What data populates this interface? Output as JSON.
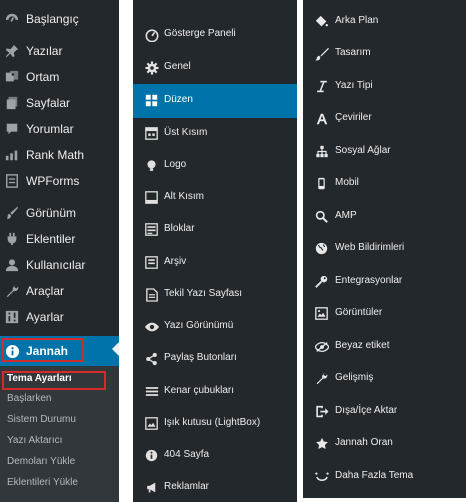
{
  "admin_menu": {
    "items": [
      {
        "label": "Başlangıç",
        "icon": "dashboard-icon"
      },
      {
        "label": "Yazılar",
        "icon": "pin-icon"
      },
      {
        "label": "Ortam",
        "icon": "media-icon"
      },
      {
        "label": "Sayfalar",
        "icon": "pages-icon"
      },
      {
        "label": "Yorumlar",
        "icon": "comments-icon"
      },
      {
        "label": "Rank Math",
        "icon": "rank-math-icon"
      },
      {
        "label": "WPForms",
        "icon": "wpforms-icon"
      },
      {
        "label": "Görünüm",
        "icon": "appearance-icon"
      },
      {
        "label": "Eklentiler",
        "icon": "plugins-icon"
      },
      {
        "label": "Kullanıcılar",
        "icon": "users-icon"
      },
      {
        "label": "Araçlar",
        "icon": "tools-icon"
      },
      {
        "label": "Ayarlar",
        "icon": "settings-icon"
      },
      {
        "label": "Jannah",
        "icon": "info-icon",
        "active": true
      }
    ],
    "submenu": [
      {
        "label": "Tema Ayarları",
        "current": true
      },
      {
        "label": "Başlarken"
      },
      {
        "label": "Sistem Durumu"
      },
      {
        "label": "Yazı Aktarıcı"
      },
      {
        "label": "Demoları Yükle"
      },
      {
        "label": "Eklentileri Yükle"
      }
    ]
  },
  "theme_panel_left": {
    "items": [
      {
        "label": "Gösterge Paneli",
        "icon": "gauge-icon"
      },
      {
        "label": "Genel",
        "icon": "gear-icon"
      },
      {
        "label": "Düzen",
        "icon": "layout-icon",
        "active": true
      },
      {
        "label": "Üst Kısım",
        "icon": "header-icon"
      },
      {
        "label": "Logo",
        "icon": "lightbulb-icon"
      },
      {
        "label": "Alt Kısım",
        "icon": "footer-icon"
      },
      {
        "label": "Bloklar",
        "icon": "blocks-icon"
      },
      {
        "label": "Arşiv",
        "icon": "archive-icon"
      },
      {
        "label": "Tekil Yazı Sayfası",
        "icon": "document-icon"
      },
      {
        "label": "Yazı Görünümü",
        "icon": "eye-icon"
      },
      {
        "label": "Paylaş Butonları",
        "icon": "share-icon"
      },
      {
        "label": "Kenar çubukları",
        "icon": "sidebars-icon"
      },
      {
        "label": "Işık kutusu (LightBox)",
        "icon": "lightbox-icon"
      },
      {
        "label": "404 Sayfa",
        "icon": "info-circle-icon"
      },
      {
        "label": "Reklamlar",
        "icon": "megaphone-icon"
      }
    ]
  },
  "theme_panel_right": {
    "items": [
      {
        "label": "Arka Plan",
        "icon": "paint-bucket-icon"
      },
      {
        "label": "Tasarım",
        "icon": "brush-icon"
      },
      {
        "label": "Yazı Tipi",
        "icon": "italic-icon"
      },
      {
        "label": "Çeviriler",
        "icon": "letter-a-icon"
      },
      {
        "label": "Sosyal Ağlar",
        "icon": "sitemap-icon"
      },
      {
        "label": "Mobil",
        "icon": "mobile-icon"
      },
      {
        "label": "AMP",
        "icon": "search-icon"
      },
      {
        "label": "Web Bildirimleri",
        "icon": "globe-icon"
      },
      {
        "label": "Entegrasyonlar",
        "icon": "key-icon"
      },
      {
        "label": "Görüntüler",
        "icon": "image-icon"
      },
      {
        "label": "Beyaz etiket",
        "icon": "eye-slash-icon"
      },
      {
        "label": "Gelişmiş",
        "icon": "wrench-icon"
      },
      {
        "label": "Dışa/İçe Aktar",
        "icon": "export-icon"
      },
      {
        "label": "Jannah Oran",
        "icon": "star-icon"
      },
      {
        "label": "Daha Fazla Tema",
        "icon": "smile-icon"
      }
    ]
  },
  "colors": {
    "menu_bg": "#23282d",
    "submenu_bg": "#32373c",
    "active_bg": "#0073aa",
    "highlight_border": "#d42a2a"
  }
}
